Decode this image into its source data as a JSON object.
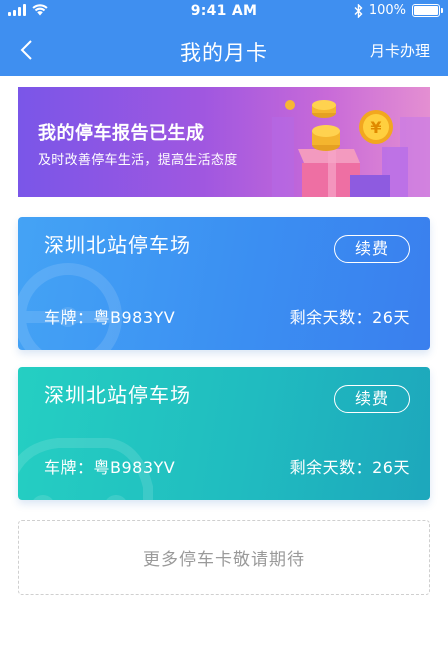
{
  "status_bar": {
    "time": "9:41 AM",
    "battery": "100%"
  },
  "nav": {
    "title": "我的月卡",
    "action_label": "月卡办理"
  },
  "banner": {
    "title": "我的停车报告已生成",
    "subtitle": "及时改善停车生活，提高生活态度",
    "coin_symbol": "¥"
  },
  "cards": [
    {
      "name": "深圳北站停车场",
      "renew_label": "续费",
      "plate": "车牌：粤B983YV",
      "days": "剩余天数：26天",
      "color": "#3b8ff2"
    },
    {
      "name": "深圳北站停车场",
      "renew_label": "续费",
      "plate": "车牌：粤B983YV",
      "days": "剩余天数：26天",
      "color": "#20bcc0"
    }
  ],
  "more_text": "更多停车卡敬请期待",
  "colors": {
    "primary": "#3f8ff0",
    "banner_start": "#7a56e8",
    "banner_end": "#e48fd2",
    "card_teal": "#20bcc0",
    "placeholder_text": "#9a9a9a"
  }
}
